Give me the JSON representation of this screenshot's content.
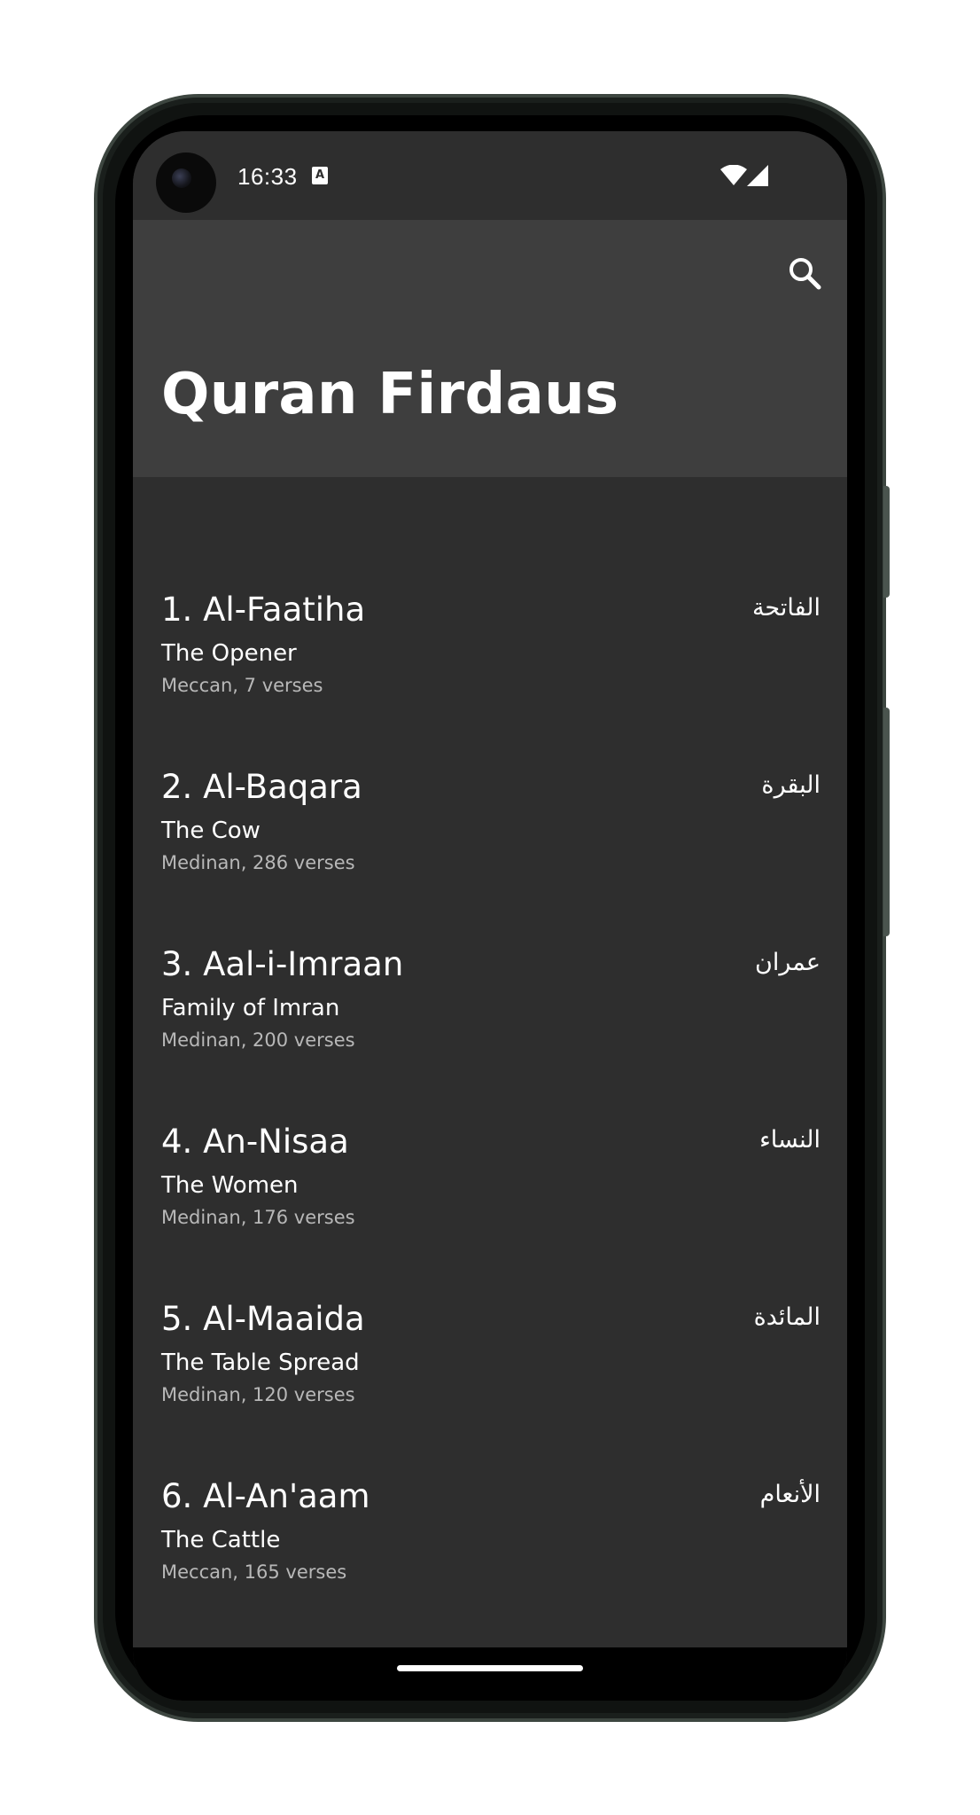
{
  "status_bar": {
    "time": "16:33",
    "notification_icon": "accessibility-a-icon",
    "icons": [
      "wifi-icon",
      "cell-signal-icon"
    ]
  },
  "app_bar": {
    "title": "Quran Firdaus",
    "search_icon": "search-icon"
  },
  "surahs": [
    {
      "name": "1. Al-Faatiha",
      "meaning": "The Opener",
      "info": "Meccan, 7 verses",
      "arabic": "الفاتحة"
    },
    {
      "name": "2. Al-Baqara",
      "meaning": "The Cow",
      "info": "Medinan, 286 verses",
      "arabic": "البقرة"
    },
    {
      "name": "3. Aal-i-Imraan",
      "meaning": "Family of Imran",
      "info": "Medinan, 200 verses",
      "arabic": "عمران"
    },
    {
      "name": "4. An-Nisaa",
      "meaning": "The Women",
      "info": "Medinan, 176 verses",
      "arabic": "النساء"
    },
    {
      "name": "5. Al-Maaida",
      "meaning": "The Table Spread",
      "info": "Medinan, 120 verses",
      "arabic": "المائدة"
    },
    {
      "name": "6. Al-An'aam",
      "meaning": "The Cattle",
      "info": "Meccan, 165 verses",
      "arabic": "الأنعام"
    }
  ],
  "colors": {
    "background": "#2e2e2e",
    "app_bar": "#3e3e3e",
    "text_primary": "#ffffff",
    "text_secondary": "#b8b8b8"
  }
}
